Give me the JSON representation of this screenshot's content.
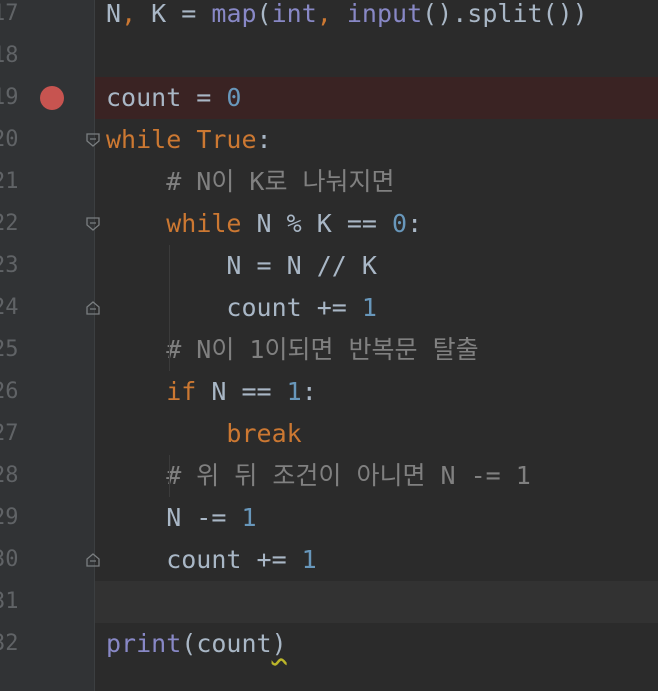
{
  "editor": {
    "lines": [
      {
        "number": "17",
        "tokens": [
          {
            "t": "N",
            "c": "op"
          },
          {
            "t": ", ",
            "c": "kw"
          },
          {
            "t": "K = ",
            "c": "op"
          },
          {
            "t": "map",
            "c": "fn"
          },
          {
            "t": "(",
            "c": "op"
          },
          {
            "t": "int",
            "c": "fn"
          },
          {
            "t": ", ",
            "c": "kw"
          },
          {
            "t": "input",
            "c": "fn"
          },
          {
            "t": "().split())",
            "c": "op"
          }
        ]
      },
      {
        "number": "18",
        "tokens": []
      },
      {
        "number": "19",
        "tokens": [
          {
            "t": "count = ",
            "c": "op"
          },
          {
            "t": "0",
            "c": "num"
          }
        ]
      },
      {
        "number": "20",
        "tokens": [
          {
            "t": "while ",
            "c": "kw"
          },
          {
            "t": "True",
            "c": "kw"
          },
          {
            "t": ":",
            "c": "op"
          }
        ]
      },
      {
        "number": "21",
        "tokens": [
          {
            "t": "    # N이 K로 나눠지면",
            "c": "cmt"
          }
        ]
      },
      {
        "number": "22",
        "tokens": [
          {
            "t": "    ",
            "c": "op"
          },
          {
            "t": "while ",
            "c": "kw"
          },
          {
            "t": "N % K == ",
            "c": "op"
          },
          {
            "t": "0",
            "c": "num"
          },
          {
            "t": ":",
            "c": "op"
          }
        ]
      },
      {
        "number": "23",
        "tokens": [
          {
            "t": "        N = N // K",
            "c": "op"
          }
        ]
      },
      {
        "number": "24",
        "tokens": [
          {
            "t": "        count += ",
            "c": "op"
          },
          {
            "t": "1",
            "c": "num"
          }
        ]
      },
      {
        "number": "25",
        "tokens": [
          {
            "t": "    # N이 1이되면 반복문 탈출",
            "c": "cmt"
          }
        ]
      },
      {
        "number": "26",
        "tokens": [
          {
            "t": "    ",
            "c": "op"
          },
          {
            "t": "if ",
            "c": "kw"
          },
          {
            "t": "N == ",
            "c": "op"
          },
          {
            "t": "1",
            "c": "num"
          },
          {
            "t": ":",
            "c": "op"
          }
        ]
      },
      {
        "number": "27",
        "tokens": [
          {
            "t": "        ",
            "c": "op"
          },
          {
            "t": "break",
            "c": "kw"
          }
        ]
      },
      {
        "number": "28",
        "tokens": [
          {
            "t": "    # 위 뒤 조건이 아니면 N -= 1",
            "c": "cmt"
          }
        ]
      },
      {
        "number": "29",
        "tokens": [
          {
            "t": "    N -= ",
            "c": "op"
          },
          {
            "t": "1",
            "c": "num"
          }
        ]
      },
      {
        "number": "30",
        "tokens": [
          {
            "t": "    count += ",
            "c": "op"
          },
          {
            "t": "1",
            "c": "num"
          }
        ]
      },
      {
        "number": "31",
        "tokens": []
      },
      {
        "number": "32",
        "tokens": [
          {
            "t": "print",
            "c": "fn"
          },
          {
            "t": "(count",
            "c": "op"
          },
          {
            "t": ")",
            "c": "op squiggle"
          }
        ]
      }
    ],
    "breakpoint_line": "19",
    "current_line": "31",
    "fold_markers": [
      {
        "line": "20",
        "kind": "fold-open-icon"
      },
      {
        "line": "22",
        "kind": "fold-open-icon"
      },
      {
        "line": "24",
        "kind": "fold-close-icon"
      },
      {
        "line": "30",
        "kind": "fold-close-icon"
      }
    ],
    "colors": {
      "background": "#2b2b2b",
      "gutter": "#313335",
      "keyword": "#cc7832",
      "number": "#6897bb",
      "builtin": "#8888c6",
      "comment": "#808080",
      "text": "#a9b7c6",
      "breakpoint": "#c75450"
    }
  }
}
